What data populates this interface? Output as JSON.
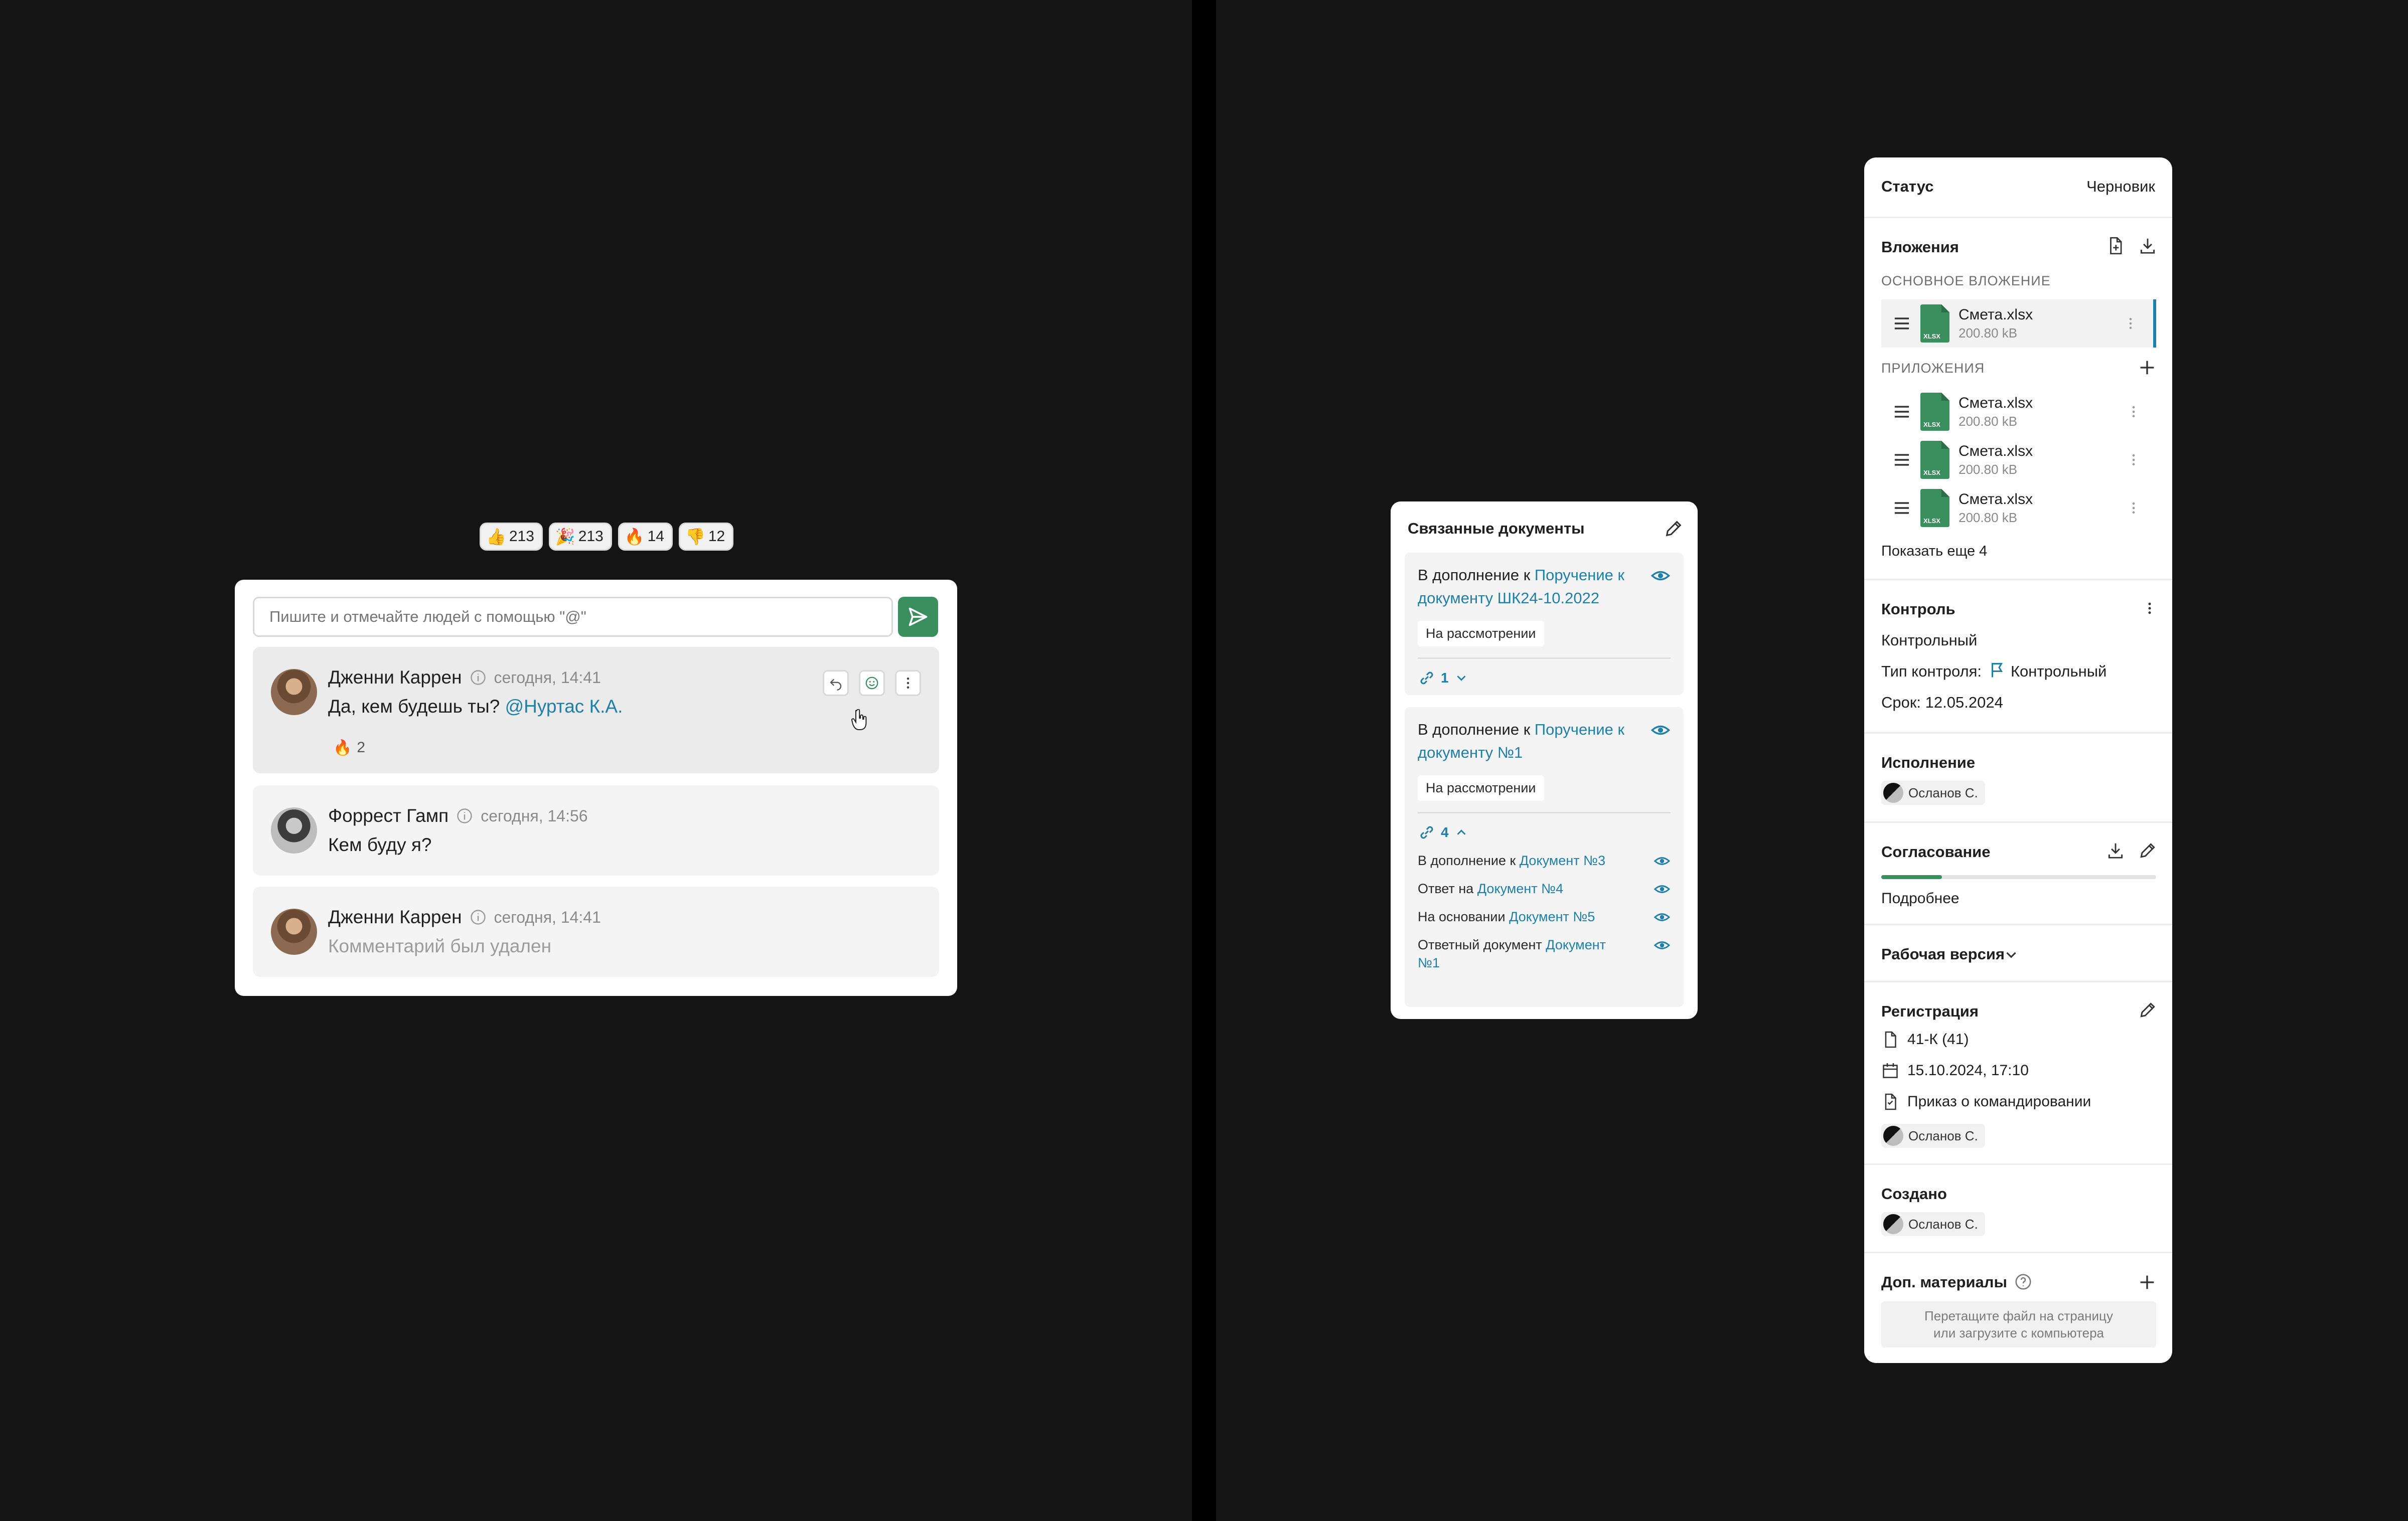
{
  "reactions": [
    {
      "emoji": "👍",
      "count": "213"
    },
    {
      "emoji": "🎉",
      "count": "213"
    },
    {
      "emoji": "🔥",
      "count": "14"
    },
    {
      "emoji": "👎",
      "count": "12"
    }
  ],
  "comments": {
    "input_placeholder": "Пишите и отмечайте людей с помощью \"@\"",
    "items": [
      {
        "author": "Дженни Каррен",
        "time": "сегодня, 14:41",
        "text": "Да, кем будешь ты?",
        "mention": "@Нуртас К.А.",
        "reaction_emoji": "🔥",
        "reaction_count": "2"
      },
      {
        "author": "Форрест Гамп",
        "time": "сегодня, 14:56",
        "text": "Кем буду я?"
      },
      {
        "author": "Дженни Каррен",
        "time": "сегодня, 14:41",
        "text": "Комментарий был удален"
      }
    ]
  },
  "related": {
    "title": "Связанные документы",
    "cards": [
      {
        "prefix": "В дополнение к",
        "link": "Поручение к документу ШК24-10.2022",
        "status": "На рассмотрении",
        "count": "1"
      },
      {
        "prefix": "В дополнение к",
        "link": "Поручение к документу №1",
        "status": "На рассмотрении",
        "count": "4",
        "subs": [
          {
            "prefix": "В дополнение к",
            "link": "Документ №3"
          },
          {
            "prefix": "Ответ на",
            "link": "Документ №4"
          },
          {
            "prefix": "На основании",
            "link": "Документ №5"
          },
          {
            "prefix": "Ответный документ",
            "link": "Документ №1"
          }
        ]
      }
    ]
  },
  "props": {
    "status_label": "Статус",
    "status_value": "Черновик",
    "attachments": {
      "title": "Вложения",
      "main_caption": "ОСНОВНОЕ ВЛОЖЕНИЕ",
      "apps_caption": "ПРИЛОЖЕНИЯ",
      "file_name": "Смета.xlsx",
      "file_size": "200.80 kB",
      "file_ext": "XLSX",
      "show_more": "Показать еще 4"
    },
    "control": {
      "title": "Контроль",
      "value": "Контрольный",
      "type_label": "Тип контроля:",
      "type_value": "Контрольный",
      "deadline": "Срок: 12.05.2024"
    },
    "execution": {
      "title": "Исполнение",
      "person": "Осланов С."
    },
    "approval": {
      "title": "Согласование",
      "more": "Подробнее",
      "progress": 0.22
    },
    "version": {
      "title": "Рабочая версия"
    },
    "registration": {
      "title": "Регистрация",
      "number": "41-К (41)",
      "datetime": "15.10.2024, 17:10",
      "doc_type": "Приказ о командировании",
      "person": "Осланов С."
    },
    "created": {
      "title": "Создано",
      "person": "Осланов С."
    },
    "extra": {
      "title": "Доп. материалы",
      "drop_line1": "Перетащите файл на страницу",
      "drop_line2": "или загрузите с компьютера"
    }
  },
  "colors": {
    "accent": "#1e7fa8",
    "green": "#3b8f5f",
    "background": "#141414"
  }
}
